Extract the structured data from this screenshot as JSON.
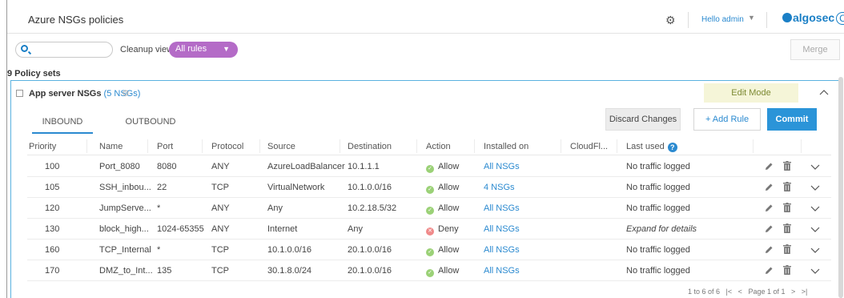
{
  "header": {
    "title": "Azure NSGs policies",
    "greeting": "Hello admin",
    "logo_text": "algosec",
    "logo_suffix": "CLOUD"
  },
  "toolbar": {
    "search_placeholder": "",
    "cleanup_label": "Cleanup view:",
    "cleanup_value": "All rules",
    "merge_label": "Merge"
  },
  "policy_sets_count": "9 Policy sets",
  "policy_set": {
    "name": "App server NSGs",
    "nsg_count": "(5 NSGs)",
    "edit_mode_label": "Edit Mode",
    "tabs": [
      {
        "label": "INBOUND",
        "active": true
      },
      {
        "label": "OUTBOUND",
        "active": false
      }
    ],
    "buttons": {
      "discard": "Discard Changes",
      "add_rule": "+ Add Rule",
      "commit": "Commit"
    },
    "columns": [
      "Priority",
      "Name",
      "Port",
      "Protocol",
      "Source",
      "Destination",
      "Action",
      "Installed on",
      "CloudFl...",
      "Last used"
    ],
    "rows": [
      {
        "priority": "100",
        "name": "Port_8080",
        "port": "8080",
        "protocol": "ANY",
        "source": "AzureLoadBalancer",
        "destination": "10.1.1.1",
        "action": "Allow",
        "installed_on": "All NSGs",
        "cloudfl": "",
        "last_used": "No traffic logged"
      },
      {
        "priority": "105",
        "name": "SSH_inbou...",
        "port": "22",
        "protocol": "TCP",
        "source": "VirtualNetwork",
        "destination": "10.1.0.0/16",
        "action": "Allow",
        "installed_on": "4 NSGs",
        "cloudfl": "",
        "last_used": "No traffic logged"
      },
      {
        "priority": "120",
        "name": "JumpServe...",
        "port": "*",
        "protocol": "ANY",
        "source": "Any",
        "destination": "10.2.18.5/32",
        "action": "Allow",
        "installed_on": "All NSGs",
        "cloudfl": "",
        "last_used": "No traffic logged"
      },
      {
        "priority": "130",
        "name": "block_high...",
        "port": "1024-65355",
        "protocol": "ANY",
        "source": "Internet",
        "destination": "Any",
        "action": "Deny",
        "installed_on": "All NSGs",
        "cloudfl": "",
        "last_used": "Expand for details"
      },
      {
        "priority": "160",
        "name": "TCP_Internal",
        "port": "*",
        "protocol": "TCP",
        "source": "10.1.0.0/16",
        "destination": "20.1.0.0/16",
        "action": "Allow",
        "installed_on": "All NSGs",
        "cloudfl": "",
        "last_used": "No traffic logged"
      },
      {
        "priority": "170",
        "name": "DMZ_to_Int...",
        "port": "135",
        "protocol": "TCP",
        "source": "30.1.8.0/24",
        "destination": "20.1.0.0/16",
        "action": "Allow",
        "installed_on": "All NSGs",
        "cloudfl": "",
        "last_used": "No traffic logged"
      }
    ],
    "pager": {
      "range": "1 to 6 of 6",
      "first": "|<",
      "prev": "<",
      "page": "Page 1 of 1",
      "next": ">",
      "last": ">|"
    }
  },
  "colors": {
    "accent": "#2b8ad0",
    "cleanup_pill": "#b46bc7",
    "allow": "#9bd177",
    "deny": "#f08a8a",
    "edit_mode_bg": "#f5f5d8",
    "panel_border": "#5ab2e0"
  },
  "icons": {
    "settings": "gear-icon",
    "search": "search-icon",
    "edit": "pencil-icon",
    "delete": "trash-icon",
    "expand": "chevron-down-icon",
    "collapse": "chevron-up-icon",
    "help": "help-icon"
  }
}
